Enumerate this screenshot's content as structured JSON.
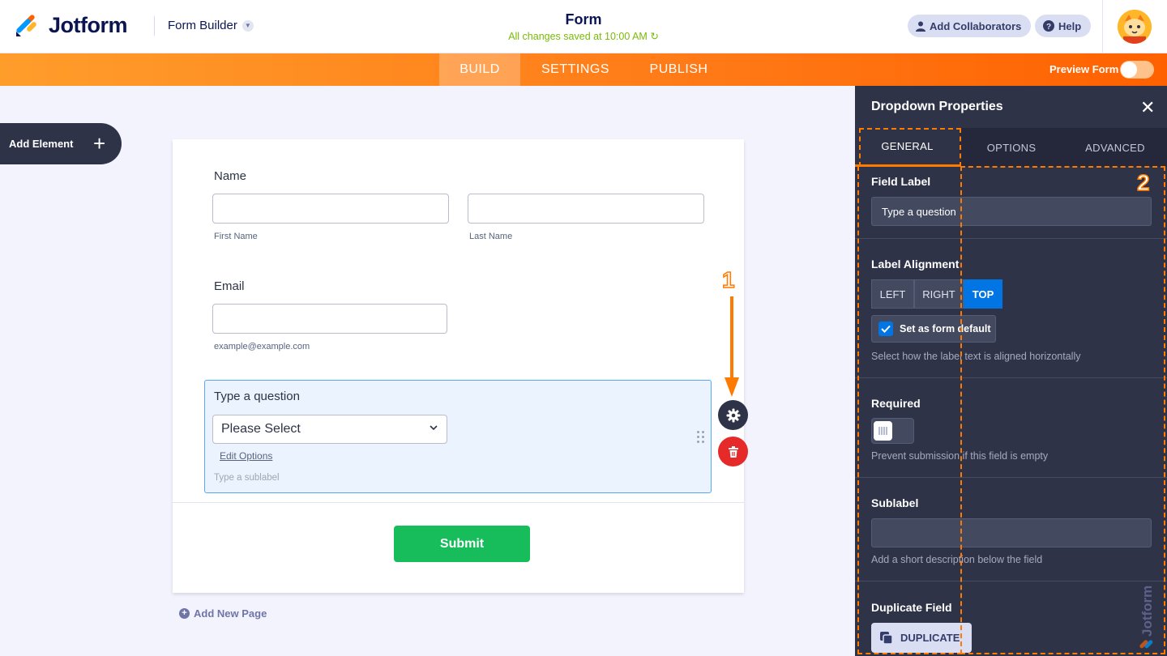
{
  "header": {
    "logo_text": "Jotform",
    "builder_label": "Form Builder",
    "form_title": "Form",
    "save_status": "All changes saved at 10:00 AM",
    "add_collaborators": "Add Collaborators",
    "help": "Help"
  },
  "nav": {
    "tabs": [
      {
        "label": "BUILD",
        "active": true
      },
      {
        "label": "SETTINGS",
        "active": false
      },
      {
        "label": "PUBLISH",
        "active": false
      }
    ],
    "preview_label": "Preview Form",
    "preview_on": false
  },
  "sidebar": {
    "add_element": "Add Element"
  },
  "form": {
    "name_label": "Name",
    "first_name_sub": "First Name",
    "last_name_sub": "Last Name",
    "email_label": "Email",
    "email_sub": "example@example.com",
    "question_label": "Type a question",
    "select_value": "Please Select",
    "edit_options": "Edit Options",
    "sublabel_placeholder": "Type a sublabel",
    "submit": "Submit",
    "add_new_page": "Add New Page"
  },
  "annotations": {
    "one": "1",
    "two": "2"
  },
  "panel": {
    "title": "Dropdown Properties",
    "tabs": [
      {
        "label": "GENERAL",
        "active": true
      },
      {
        "label": "OPTIONS",
        "active": false
      },
      {
        "label": "ADVANCED",
        "active": false
      }
    ],
    "field_label_title": "Field Label",
    "field_label_value": "Type a question",
    "label_alignment_title": "Label Alignment",
    "alignment_options": [
      "LEFT",
      "RIGHT",
      "TOP"
    ],
    "alignment_selected": "TOP",
    "set_default": "Set as form default",
    "set_default_checked": true,
    "alignment_help": "Select how the label text is aligned horizontally",
    "required_title": "Required",
    "required_on": false,
    "required_help": "Prevent submission if this field is empty",
    "sublabel_title": "Sublabel",
    "sublabel_value": "",
    "sublabel_help": "Add a short description below the field",
    "duplicate_title": "Duplicate Field",
    "duplicate_button": "DUPLICATE"
  },
  "colors": {
    "brand_navy": "#0a1551",
    "orange": "#ff7a00",
    "panel_bg": "#2f3347",
    "accent_blue": "#0075e3",
    "submit_green": "#18bd5b",
    "saved_green": "#78bb07",
    "delete_red": "#e62a2a"
  },
  "icons": [
    "jotform-logo-icon",
    "chevron-down-icon",
    "user-icon",
    "help-icon",
    "refresh-icon",
    "avatar-icon",
    "plus-icon",
    "gear-icon",
    "trash-icon",
    "drag-handle-icon",
    "close-icon",
    "check-icon",
    "duplicate-icon",
    "arrow-down-icon"
  ]
}
